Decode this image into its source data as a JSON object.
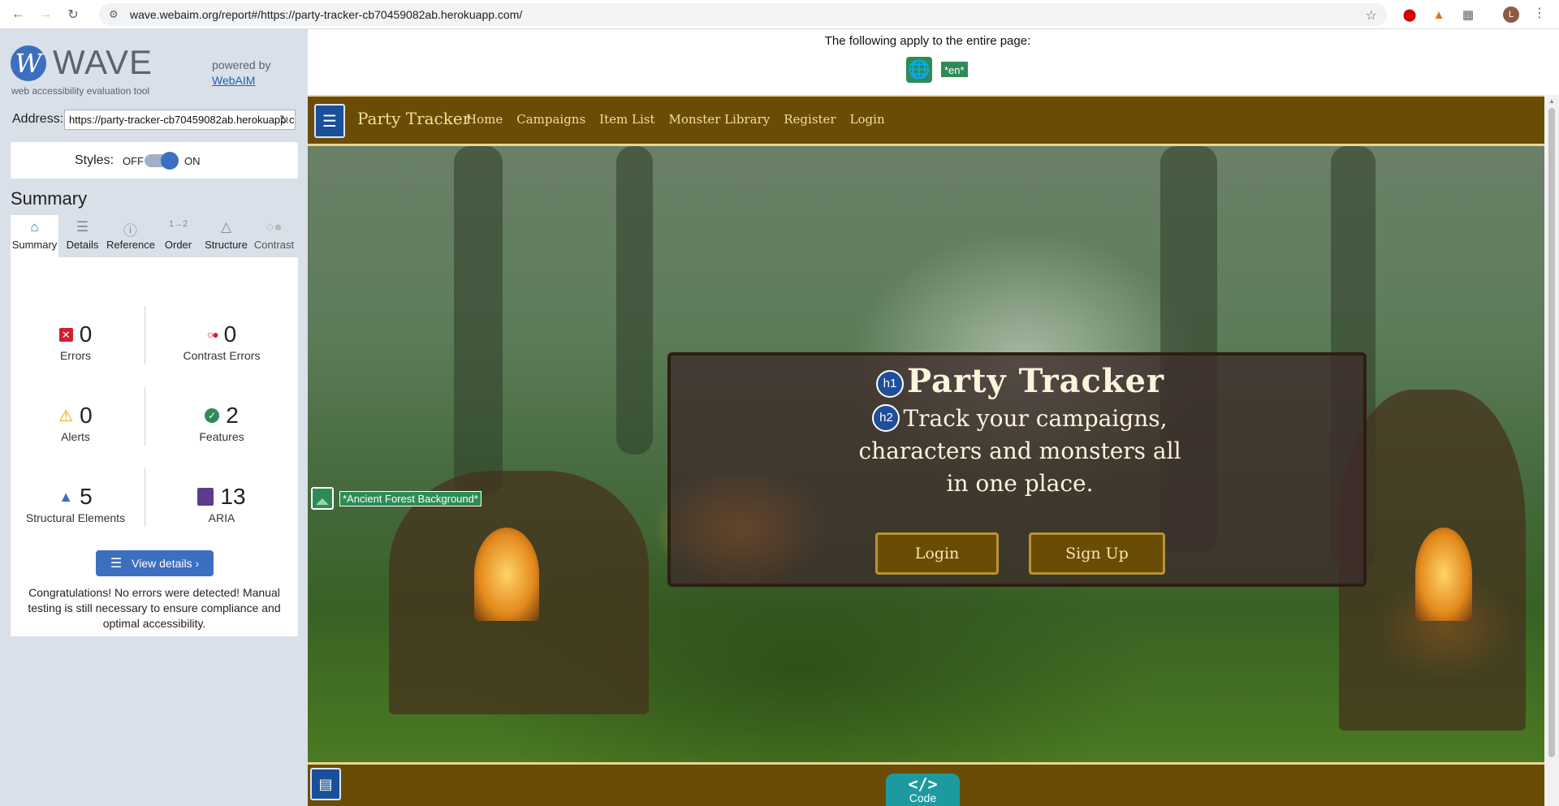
{
  "browser": {
    "url": "wave.webaim.org/report#/https://party-tracker-cb70459082ab.herokuapp.com/",
    "profile_initial": "L"
  },
  "wave": {
    "logo_letter": "W",
    "name": "WAVE",
    "tagline": "web accessibility evaluation tool",
    "powered_by": "powered by",
    "powered_link": "WebAIM",
    "address_label": "Address:",
    "address_value": "https://party-tracker-cb70459082ab.herokuapp.com/",
    "styles_label": "Styles:",
    "styles_off": "OFF",
    "styles_on": "ON",
    "styles_state": "on",
    "summary_heading": "Summary",
    "tabs": [
      {
        "label": "Summary",
        "icon": "home-icon"
      },
      {
        "label": "Details",
        "icon": "list-icon"
      },
      {
        "label": "Reference",
        "icon": "info-icon"
      },
      {
        "label": "Order",
        "icon": "order-icon"
      },
      {
        "label": "Structure",
        "icon": "structure-icon"
      },
      {
        "label": "Contrast",
        "icon": "contrast-icon"
      }
    ],
    "stats": {
      "errors": {
        "count": "0",
        "label": "Errors"
      },
      "contrast_errors": {
        "count": "0",
        "label": "Contrast Errors"
      },
      "alerts": {
        "count": "0",
        "label": "Alerts"
      },
      "features": {
        "count": "2",
        "label": "Features"
      },
      "structural": {
        "count": "5",
        "label": "Structural Elements"
      },
      "aria": {
        "count": "13",
        "label": "ARIA"
      }
    },
    "view_details": "View details ›",
    "congrats": "Congratulations! No errors were detected! Manual testing is still necessary to ensure compliance and optimal accessibility."
  },
  "report": {
    "applies_text": "The following apply to the entire page:",
    "lang_tag": "*en*",
    "image_tag": "*Ancient Forest Background*",
    "h1_marker": "h1",
    "h2_marker": "h2",
    "code_label": "Code",
    "code_symbol": "</>"
  },
  "site": {
    "brand": "Party Tracker",
    "nav": [
      "Home",
      "Campaigns",
      "Item List",
      "Monster Library",
      "Register",
      "Login"
    ],
    "hero_title": "Party Tracker",
    "hero_subtitle": "Track your campaigns, characters and monsters all in one place.",
    "login_button": "Login",
    "signup_button": "Sign Up"
  },
  "colors": {
    "wave_blue": "#3d6fc0",
    "site_brown": "#6b4c04",
    "feature_green": "#2e8b57",
    "error_red": "#d21f2d"
  }
}
